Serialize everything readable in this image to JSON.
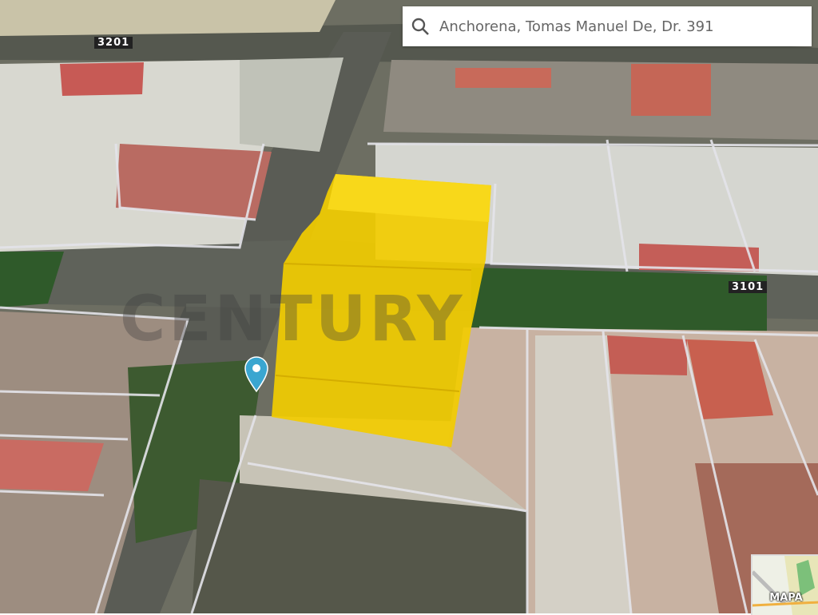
{
  "search": {
    "value": "Anchorena, Tomas Manuel De, Dr. 391",
    "icon": "search-icon"
  },
  "streets": [
    "3201",
    "3101"
  ],
  "watermark": "CENTURY",
  "minimap": {
    "label": "MAPA"
  },
  "colors": {
    "highlight": "#f2cc00",
    "pin": "#3aa6d0"
  }
}
